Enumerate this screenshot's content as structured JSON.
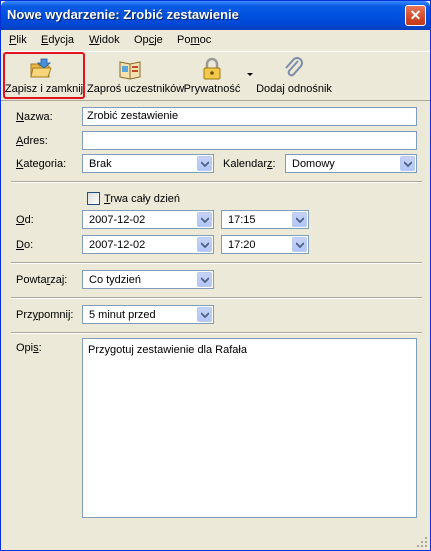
{
  "window": {
    "title": "Nowe wydarzenie: Zrobić zestawienie"
  },
  "menu": [
    {
      "pre": "",
      "key": "P",
      "post": "lik"
    },
    {
      "pre": "",
      "key": "E",
      "post": "dycja"
    },
    {
      "pre": "",
      "key": "W",
      "post": "idok"
    },
    {
      "pre": "Op",
      "key": "c",
      "post": "je"
    },
    {
      "pre": "Po",
      "key": "m",
      "post": "oc"
    }
  ],
  "toolbar": {
    "save_close": "Zapisz i zamknij",
    "invite": "Zaproś uczestników",
    "privacy": "Prywatność",
    "add_link": "Dodaj odnośnik"
  },
  "form": {
    "name_label_key": "N",
    "name_label_rest": "azwa:",
    "name_value": "Zrobić zestawienie",
    "address_label_key": "A",
    "address_label_rest": "dres:",
    "address_value": "",
    "category_label_key": "K",
    "category_label_rest": "ategoria:",
    "category_value": "Brak",
    "calendar_label_pre": "Kalendar",
    "calendar_label_key": "z",
    "calendar_label_post": ":",
    "calendar_value": "Domowy",
    "allday_key": "T",
    "allday_rest": "rwa cały dzień",
    "allday_checked": false,
    "from_label_key": "O",
    "from_label_rest": "d:",
    "from_date": "2007-12-02",
    "from_time": "17:15",
    "to_label_key": "D",
    "to_label_rest": "o:",
    "to_date": "2007-12-02",
    "to_time": "17:20",
    "repeat_label_pre": "Powta",
    "repeat_label_key": "r",
    "repeat_label_post": "zaj:",
    "repeat_value": "Co tydzień",
    "remind_label_pre": "Prz",
    "remind_label_key": "y",
    "remind_label_post": "pomnij:",
    "remind_value": "5 minut przed",
    "desc_label_pre": "Opi",
    "desc_label_key": "s",
    "desc_label_post": ":",
    "desc_value": "Przygotuj zestawienie dla Rafała"
  },
  "colors": {
    "title_bar": "#0050E0",
    "highlight": "#E0141E",
    "window_bg": "#ECE9D8"
  }
}
